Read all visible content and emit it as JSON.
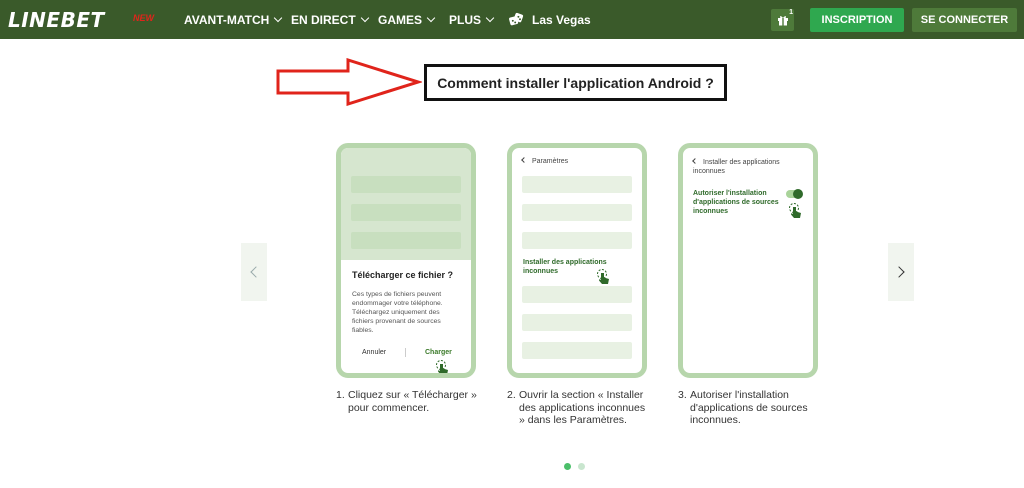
{
  "header": {
    "logo": "LINEBET",
    "promo_badge": "NEW",
    "nav": [
      {
        "label": "AVANT-MATCH",
        "has_dropdown": true
      },
      {
        "label": "EN DIRECT",
        "has_dropdown": true
      },
      {
        "label": "GAMES",
        "has_dropdown": true
      },
      {
        "label": "PLUS",
        "has_dropdown": true
      },
      {
        "label": "Las Vegas",
        "has_dropdown": false,
        "icon": "dice-icon"
      }
    ],
    "gift_badge": "1",
    "register_label": "INSCRIPTION",
    "login_label": "SE CONNECTER"
  },
  "heading": {
    "title": "Comment installer l'application Android ?"
  },
  "steps": [
    {
      "dialog_title": "Télécharger ce fichier ?",
      "dialog_body": "Ces types de fichiers peuvent endommager votre téléphone. Téléchargez uniquement des fichiers provenant de sources fiables.",
      "cancel_label": "Annuler",
      "confirm_label": "Charger",
      "number": "1.",
      "caption": "Cliquez sur « Télécharger » pour commencer."
    },
    {
      "screen_title": "Paramètres",
      "highlight_label": "Installer des applications inconnues",
      "number": "2.",
      "caption": "Ouvrir la section « Installer des applications inconnues » dans les Paramètres."
    },
    {
      "screen_title": "Installer des applications inconnues",
      "toggle_label": "Autoriser l'installation d'applications de sources inconnues",
      "toggle_on": true,
      "number": "3.",
      "caption": "Autoriser l'installation d'applications de sources inconnues."
    }
  ],
  "carousel": {
    "active_page": 1,
    "page_count": 2
  },
  "colors": {
    "header_bg": "#3a5a2a",
    "register_bg": "#2fa84f",
    "login_bg": "#4e7a3a",
    "phone_border": "#b7d6ac",
    "annotation_arrow": "#e0241b"
  }
}
